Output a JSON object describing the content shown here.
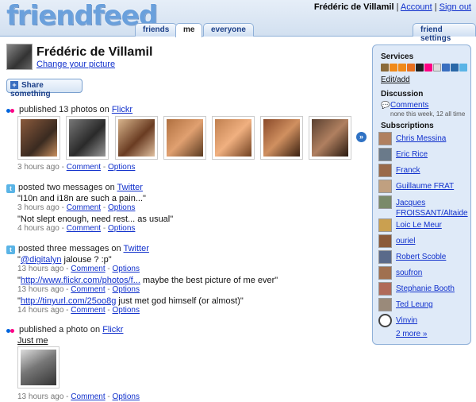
{
  "header": {
    "logo": "friendfeed",
    "username": "Frédéric de Villamil",
    "separator": "|",
    "account": "Account",
    "signout": "Sign out",
    "tabs": [
      "friends",
      "me",
      "everyone"
    ],
    "settings_tab": "friend settings"
  },
  "profile": {
    "name": "Frédéric de Villamil",
    "change_picture": "Change your picture",
    "share": "Share something"
  },
  "feed": [
    {
      "service": "flickr-icon",
      "head_prefix": "published 13 photos on ",
      "service_link": "Flickr",
      "time": "3 hours ago",
      "comment": "Comment",
      "options": "Options"
    },
    {
      "service": "twitter-icon",
      "head_prefix": "posted two messages on ",
      "service_link": "Twitter",
      "messages": [
        {
          "text": "\"I10n and i18n are such a pain...\"",
          "time": "3 hours ago"
        },
        {
          "text": "\"Not slept enough, need rest... as usual\"",
          "time": "4 hours ago"
        }
      ]
    },
    {
      "service": "twitter-icon",
      "head_prefix": "posted three messages on ",
      "service_link": "Twitter",
      "messages": [
        {
          "link": "@digitalyn",
          "text": " jalouse ? :p\"",
          "time": "13 hours ago"
        },
        {
          "link": "http://www.flickr.com/photos/f...",
          "text": " maybe the best picture of me ever\"",
          "time": "13 hours ago"
        },
        {
          "link": "http://tinyurl.com/25oo8g",
          "text": " just met god himself (or almost)\"",
          "time": "14 hours ago"
        }
      ]
    },
    {
      "service": "flickr-icon",
      "head_prefix": "published a photo on ",
      "service_link": "Flickr",
      "photo_title": "Just me",
      "time": "13 hours ago"
    }
  ],
  "meta_labels": {
    "sep": " - ",
    "comment": "Comment",
    "options": "Options",
    "quote": "\""
  },
  "sidebar": {
    "services_title": "Services",
    "edit_add": "Edit/add",
    "discussion_title": "Discussion",
    "comments_link": "Comments",
    "comments_note": "none this week, 12 all time",
    "subscriptions_title": "Subscriptions",
    "subscriptions": [
      "Chris Messina",
      "Eric Rice",
      "Franck",
      "Guillaume FRAT",
      "Jacques FROISSANT/Altaide",
      "Loic Le Meur",
      "ouriel",
      "Robert Scoble",
      "soufron",
      "Stephanie Booth",
      "Ted Leung",
      "Vinvin"
    ],
    "more": "2 more »"
  },
  "colors": {
    "accent": "#1030cc",
    "header_bg": "#d2e0f0",
    "sidebar_bg": "#dfeaf8",
    "flickr_pink": "#ff0084",
    "flickr_blue": "#0063dc"
  }
}
